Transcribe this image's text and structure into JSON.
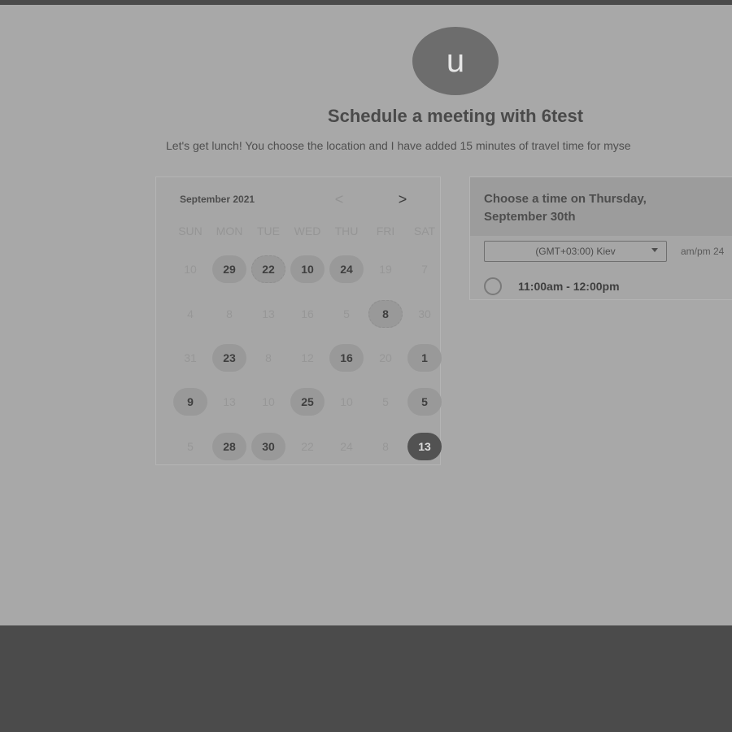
{
  "colors": {
    "page_bg": "#a8a8a8",
    "frame": "#4b4b4b",
    "available_day": "#999999",
    "selected_day": "#525252"
  },
  "host": {
    "avatar_letter": "u"
  },
  "heading": {
    "title": "Schedule a meeting with 6test",
    "subtitle": "Let's get lunch! You choose the location and I have added 15 minutes of travel time for myse"
  },
  "calendar": {
    "month_label": "September 2021",
    "prev_icon": "chevron-left-icon",
    "next_icon": "chevron-right-icon",
    "prev_glyph": "<",
    "next_glyph": ">",
    "weekdays": [
      "SUN",
      "MON",
      "TUE",
      "WED",
      "THU",
      "FRI",
      "SAT"
    ],
    "weeks": [
      [
        {
          "label": "10",
          "state": "off"
        },
        {
          "label": "29",
          "state": "available"
        },
        {
          "label": "22",
          "state": "available-outlined"
        },
        {
          "label": "10",
          "state": "available"
        },
        {
          "label": "24",
          "state": "available"
        },
        {
          "label": "19",
          "state": "off"
        },
        {
          "label": "7",
          "state": "off"
        }
      ],
      [
        {
          "label": "4",
          "state": "off"
        },
        {
          "label": "8",
          "state": "off"
        },
        {
          "label": "13",
          "state": "off"
        },
        {
          "label": "16",
          "state": "off"
        },
        {
          "label": "5",
          "state": "off"
        },
        {
          "label": "8",
          "state": "available-outlined"
        },
        {
          "label": "30",
          "state": "off"
        }
      ],
      [
        {
          "label": "31",
          "state": "off"
        },
        {
          "label": "23",
          "state": "available"
        },
        {
          "label": "8",
          "state": "off"
        },
        {
          "label": "12",
          "state": "off"
        },
        {
          "label": "16",
          "state": "available"
        },
        {
          "label": "20",
          "state": "off"
        },
        {
          "label": "1",
          "state": "available"
        }
      ],
      [
        {
          "label": "9",
          "state": "available"
        },
        {
          "label": "13",
          "state": "off"
        },
        {
          "label": "10",
          "state": "off"
        },
        {
          "label": "25",
          "state": "available"
        },
        {
          "label": "10",
          "state": "off"
        },
        {
          "label": "5",
          "state": "off"
        },
        {
          "label": "5",
          "state": "available"
        }
      ],
      [
        {
          "label": "5",
          "state": "off"
        },
        {
          "label": "28",
          "state": "available"
        },
        {
          "label": "30",
          "state": "available"
        },
        {
          "label": "22",
          "state": "off"
        },
        {
          "label": "24",
          "state": "off"
        },
        {
          "label": "8",
          "state": "off"
        },
        {
          "label": "13",
          "state": "selected"
        }
      ]
    ]
  },
  "times": {
    "heading": "Choose a time on Thursday, September 30th",
    "timezone": "(GMT+03:00) Kiev",
    "format_label": "am/pm  24",
    "slots": [
      {
        "label": "11:00am - 12:00pm"
      }
    ]
  }
}
